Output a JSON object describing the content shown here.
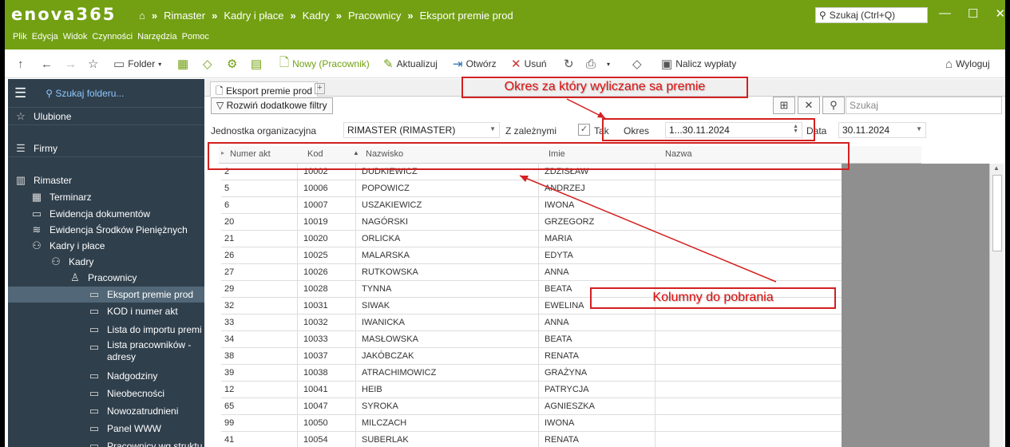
{
  "app": {
    "logo": "enova365",
    "search_placeholder": "Szukaj (Ctrl+Q)",
    "logout": "Wyloguj"
  },
  "breadcrumbs": [
    "Rimaster",
    "Kadry i płace",
    "Kadry",
    "Pracownicy",
    "Eksport premie prod"
  ],
  "menu": [
    "Plik",
    "Edycja",
    "Widok",
    "Czynności",
    "Narzędzia",
    "Pomoc"
  ],
  "toolbar": {
    "folder": "Folder",
    "new": "Nowy (Pracownik)",
    "update": "Aktualizuj",
    "open": "Otwórz",
    "delete": "Usuń",
    "calc": "Nalicz wypłaty"
  },
  "sidebar": {
    "search": "Szukaj folderu...",
    "items": [
      {
        "label": "Ulubione",
        "icon": "star-icon"
      },
      {
        "label": "Firmy",
        "icon": "database-icon"
      },
      {
        "label": "Rimaster",
        "icon": "building-icon"
      },
      {
        "label": "Terminarz",
        "icon": "calendar-icon"
      },
      {
        "label": "Ewidencja dokumentów",
        "icon": "inbox-icon"
      },
      {
        "label": "Ewidencja Środków Pieniężnych",
        "icon": "coins-icon"
      },
      {
        "label": "Kadry i płace",
        "icon": "people-icon"
      },
      {
        "label": "Kadry",
        "icon": "people-icon"
      },
      {
        "label": "Pracownicy",
        "icon": "person-icon"
      },
      {
        "label": "Eksport premie prod",
        "icon": "folder-icon"
      },
      {
        "label": "KOD i numer akt",
        "icon": "folder-icon"
      },
      {
        "label": "Lista do importu premi",
        "icon": "folder-icon"
      },
      {
        "label": "Lista pracowników -",
        "label2": "adresy",
        "icon": "folder-icon"
      },
      {
        "label": "Nadgodziny",
        "icon": "folder-icon"
      },
      {
        "label": "Nieobecności",
        "icon": "folder-icon"
      },
      {
        "label": "Nowozatrudnieni",
        "icon": "folder-icon"
      },
      {
        "label": "Panel WWW",
        "icon": "folder-icon"
      },
      {
        "label": "Pracownicy wg struktu",
        "icon": "folder-icon"
      }
    ]
  },
  "tab": {
    "label": "Eksport premie prod"
  },
  "filters": {
    "expand": "Rozwiń dodatkowe filtry",
    "search": "Szukaj",
    "unit_label": "Jednostka organizacyjna",
    "unit_value": "RIMASTER (RIMASTER)",
    "with_children": "Z zależnymi",
    "yes": "Tak",
    "period_label": "Okres",
    "period_value": "1...30.11.2024",
    "date_label": "Data",
    "date_value": "30.11.2024"
  },
  "grid": {
    "columns": [
      "Numer akt",
      "Kod",
      "Nazwisko",
      "Imie",
      "Nazwa"
    ],
    "rows": [
      [
        "2",
        "10002",
        "DUDKIEWICZ",
        "ZDZISŁAW"
      ],
      [
        "5",
        "10006",
        "POPOWICZ",
        "ANDRZEJ"
      ],
      [
        "6",
        "10007",
        "USZAKIEWICZ",
        "IWONA"
      ],
      [
        "20",
        "10019",
        "NAGÓRSKI",
        "GRZEGORZ"
      ],
      [
        "21",
        "10020",
        "ORLICKA",
        "MARIA"
      ],
      [
        "26",
        "10025",
        "MALARSKA",
        "EDYTA"
      ],
      [
        "27",
        "10026",
        "RUTKOWSKA",
        "ANNA"
      ],
      [
        "29",
        "10028",
        "TYNNA",
        "BEATA"
      ],
      [
        "32",
        "10031",
        "SIWAK",
        "EWELINA"
      ],
      [
        "33",
        "10032",
        "IWANICKA",
        "ANNA"
      ],
      [
        "34",
        "10033",
        "MASŁOWSKA",
        "BEATA"
      ],
      [
        "38",
        "10037",
        "JAKÓBCZAK",
        "RENATA"
      ],
      [
        "39",
        "10038",
        "ATRACHIMOWICZ",
        "GRAŻYNA"
      ],
      [
        "12",
        "10041",
        "HEIB",
        "PATRYCJA"
      ],
      [
        "65",
        "10047",
        "SYROKA",
        "AGNIESZKA"
      ],
      [
        "99",
        "10050",
        "MILCZACH",
        "IWONA"
      ],
      [
        "41",
        "10054",
        "SUBERLAK",
        "RENATA"
      ]
    ]
  },
  "annotations": {
    "period": "Okres za który wyliczane sa premie",
    "columns": "Kolumny do pobrania"
  },
  "colors": {
    "brand": "#72a012",
    "sidebar": "#2f3f4c",
    "annotation": "#d32020"
  }
}
